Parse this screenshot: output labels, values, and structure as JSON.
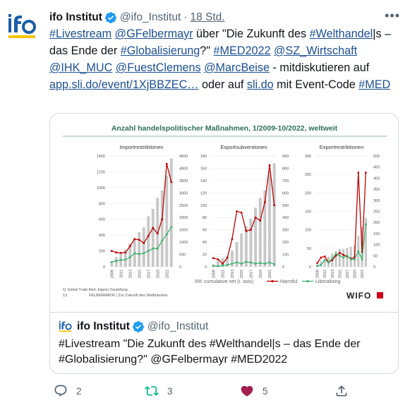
{
  "author": {
    "name": "ifo Institut",
    "handle": "@ifo_Institut",
    "time": "18 Std.",
    "logo_text": "ifo"
  },
  "tweet": {
    "parts": [
      {
        "t": "#Livestream",
        "link": true
      },
      {
        "t": " ",
        "link": false
      },
      {
        "t": "@GFelbermayr",
        "link": true
      },
      {
        "t": " über \"Die Zukunft des ",
        "link": false
      },
      {
        "t": "#Welthandel",
        "link": true
      },
      {
        "t": "|s – das Ende der ",
        "link": false
      },
      {
        "t": "#Globalisierung",
        "link": true
      },
      {
        "t": "?\" ",
        "link": false
      },
      {
        "t": "#MED2022",
        "link": true
      },
      {
        "t": " ",
        "link": false
      },
      {
        "t": "@SZ_Wirtschaft",
        "link": true
      },
      {
        "t": " ",
        "link": false
      },
      {
        "t": "@IHK_MUC",
        "link": true
      },
      {
        "t": " ",
        "link": false
      },
      {
        "t": "@FuestClemens",
        "link": true
      },
      {
        "t": " ",
        "link": false
      },
      {
        "t": "@MarcBeise",
        "link": true
      },
      {
        "t": " - mitdiskutieren auf ",
        "link": false
      },
      {
        "t": "app.sli.do/event/1XjBBZEC…",
        "link": true
      },
      {
        "t": " oder auf ",
        "link": false
      },
      {
        "t": "sli.do",
        "link": true
      },
      {
        "t": " mit Event-Code ",
        "link": false
      },
      {
        "t": "#MED",
        "link": true
      }
    ]
  },
  "quote": {
    "name": "ifo Institut",
    "handle": "@ifo_Institut",
    "text": "#Livestream \"Die Zukunft des #Welthandel|s – das Ende der #Globalisierung?\" @GFelbermayr #MED2022"
  },
  "actions": {
    "replies": "2",
    "retweets": "3",
    "likes": "5"
  },
  "colors": {
    "harmful": "#c00000",
    "liberalising": "#3cb371",
    "bars": "#c8c8c8",
    "title": "#2e6e5a",
    "link": "#1d4f91"
  },
  "chart_data": [
    {
      "type": "bar+line",
      "title": "Anzahl handelspolitischer Maßnahmen, 1/2009-10/2022, weltweit",
      "subtitle": "Importrestriktionen",
      "x": [
        "2009",
        "2010",
        "2011",
        "2012",
        "2013",
        "2014",
        "2015",
        "2016",
        "2017",
        "2018",
        "2019",
        "2020",
        "2021",
        "2022"
      ],
      "x_labels": [
        "2009",
        "2011",
        "2013",
        "2015",
        "2017",
        "2019",
        "2021"
      ],
      "left_ticks": [
        "0",
        "200",
        "400",
        "600",
        "800",
        "1000",
        "1200",
        "1400"
      ],
      "right_ticks": [
        "0",
        "500",
        "1000",
        "1500",
        "2000",
        "2500",
        "3000",
        "3500",
        "4000",
        "4500"
      ],
      "ylim_left": [
        0,
        1400
      ],
      "ylim_right": [
        0,
        4500
      ],
      "series": [
        {
          "name": "cumulative net (r. axis)",
          "kind": "bar",
          "axis": "right",
          "values": [
            200,
            400,
            550,
            700,
            950,
            1150,
            1400,
            1600,
            2050,
            2350,
            2800,
            3100,
            3700,
            4400
          ]
        },
        {
          "name": "Harmful",
          "kind": "line",
          "axis": "left",
          "values": [
            200,
            180,
            175,
            180,
            260,
            350,
            340,
            300,
            390,
            490,
            420,
            600,
            1300,
            1070
          ]
        },
        {
          "name": "Liberalising",
          "kind": "line",
          "axis": "left",
          "values": [
            60,
            75,
            85,
            90,
            120,
            170,
            160,
            170,
            200,
            230,
            230,
            330,
            410,
            500
          ]
        }
      ]
    },
    {
      "type": "bar+line",
      "subtitle": "Exportsubventionen",
      "x": [
        "2009",
        "2010",
        "2011",
        "2012",
        "2013",
        "2014",
        "2015",
        "2016",
        "2017",
        "2018",
        "2019",
        "2020",
        "2021",
        "2022"
      ],
      "x_labels": [
        "2009",
        "2011",
        "2013",
        "2015",
        "2017",
        "2019",
        "2021"
      ],
      "left_ticks": [
        "0",
        "20",
        "40",
        "60",
        "80",
        "100",
        "120",
        "140",
        "160",
        "180"
      ],
      "right_ticks": [
        "0",
        "100",
        "200",
        "300",
        "400",
        "500",
        "600",
        "700",
        "800",
        "900"
      ],
      "ylim_left": [
        0,
        180
      ],
      "ylim_right": [
        0,
        900
      ],
      "series": [
        {
          "name": "cumulative net (r. axis)",
          "kind": "bar",
          "axis": "right",
          "values": [
            20,
            50,
            70,
            80,
            130,
            200,
            270,
            330,
            390,
            480,
            560,
            620,
            780,
            840
          ]
        },
        {
          "name": "Harmful",
          "kind": "line",
          "axis": "left",
          "values": [
            14,
            12,
            5,
            15,
            45,
            90,
            88,
            58,
            60,
            80,
            75,
            105,
            165,
            100
          ]
        },
        {
          "name": "Liberalising",
          "kind": "line",
          "axis": "left",
          "values": [
            1,
            1,
            2,
            3,
            5,
            7,
            5,
            8,
            7,
            5,
            6,
            5,
            7,
            4
          ]
        }
      ]
    },
    {
      "type": "bar+line",
      "subtitle": "Exportrestriktionen",
      "x": [
        "2009",
        "2010",
        "2011",
        "2012",
        "2013",
        "2014",
        "2015",
        "2016",
        "2017",
        "2018",
        "2019",
        "2020",
        "2021",
        "2022"
      ],
      "x_labels": [
        "2009",
        "2011",
        "2013",
        "2015",
        "2017",
        "2019",
        "2021"
      ],
      "left_ticks": [
        "0",
        "50",
        "100",
        "150",
        "200",
        "250",
        "300"
      ],
      "right_ticks": [
        "0",
        "50",
        "100",
        "150",
        "200",
        "250",
        "300",
        "350",
        "400",
        "450",
        "500"
      ],
      "ylim_left": [
        0,
        300
      ],
      "ylim_right": [
        0,
        500
      ],
      "series": [
        {
          "name": "cumulative net (r. axis)",
          "kind": "bar",
          "axis": "right",
          "values": [
            10,
            25,
            35,
            45,
            60,
            70,
            80,
            80,
            85,
            90,
            95,
            140,
            180,
            220
          ]
        },
        {
          "name": "Harmful",
          "kind": "line",
          "axis": "left",
          "values": [
            10,
            25,
            28,
            12,
            18,
            30,
            38,
            32,
            28,
            22,
            25,
            255,
            40,
            255
          ]
        },
        {
          "name": "Liberalising",
          "kind": "line",
          "axis": "left",
          "values": [
            2,
            5,
            18,
            12,
            22,
            35,
            30,
            25,
            30,
            20,
            20,
            42,
            20,
            115
          ]
        }
      ]
    }
  ],
  "chart_legend": [
    "cumulative net (r. axis)",
    "Harmful",
    "Liberalising"
  ],
  "chart_source": "Q: Global Trade Alert, Eigene Darstellung.",
  "chart_footer_num": "13",
  "chart_footer_text": "FELBERMAYR | Zur Zukunft des Welthandels",
  "chart_logo": "WIFO"
}
